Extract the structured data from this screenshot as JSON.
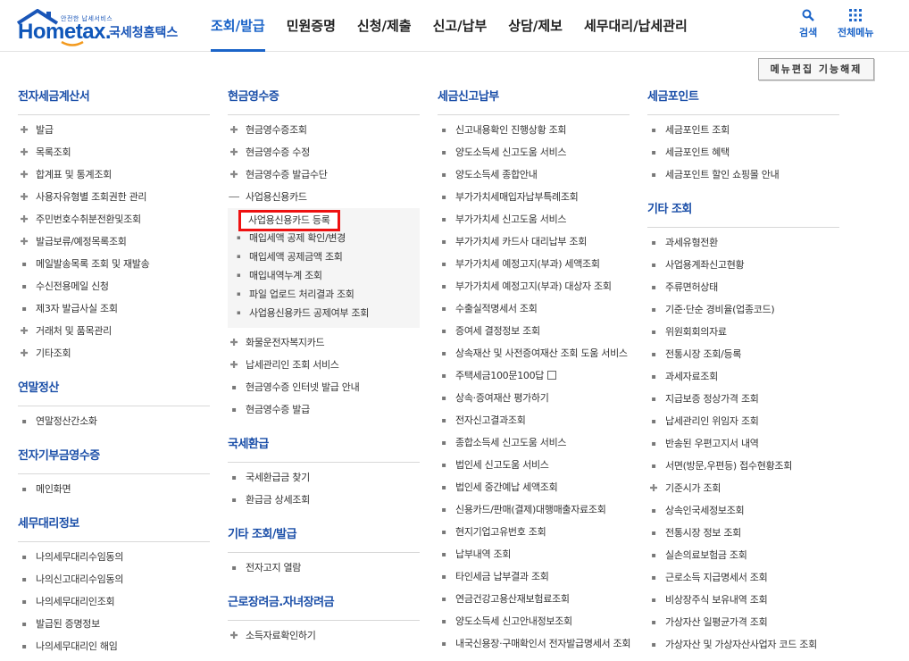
{
  "header": {
    "logo_small": "안전한 납세서비스",
    "logo_brand_a": "Hom",
    "logo_brand_e": "e",
    "logo_brand_b": "tax.",
    "logo_name": "국세청홈택스",
    "nav": [
      "조회/발급",
      "민원증명",
      "신청/제출",
      "신고/납부",
      "상담/제보",
      "세무대리/납세관리"
    ],
    "search_label": "검색",
    "allmenu_label": "전체메뉴"
  },
  "menu_edit_label": "메뉴편집 기능해제",
  "colors": {
    "brand": "#1a56b8",
    "accent": "#1b64c8",
    "highlight": "#ee1111"
  },
  "col1": [
    {
      "title": "전자세금계산서",
      "items": [
        {
          "label": "발급",
          "marker": "plus"
        },
        {
          "label": "목록조회",
          "marker": "plus"
        },
        {
          "label": "합계표 및 통계조회",
          "marker": "plus"
        },
        {
          "label": "사용자유형별 조회권한 관리",
          "marker": "plus"
        },
        {
          "label": "주민번호수취분전환및조회",
          "marker": "plus"
        },
        {
          "label": "발급보류/예정목록조회",
          "marker": "plus"
        },
        {
          "label": "메일발송목록 조회 및 재발송",
          "marker": "dot"
        },
        {
          "label": "수신전용메일 신청",
          "marker": "dot"
        },
        {
          "label": "제3자 발급사실 조회",
          "marker": "dot"
        },
        {
          "label": "거래처 및 품목관리",
          "marker": "plus"
        },
        {
          "label": "기타조회",
          "marker": "plus"
        }
      ]
    },
    {
      "title": "연말정산",
      "items": [
        {
          "label": "연말정산간소화",
          "marker": "dot"
        }
      ]
    },
    {
      "title": "전자기부금영수증",
      "items": [
        {
          "label": "메인화면",
          "marker": "dot"
        }
      ]
    },
    {
      "title": "세무대리정보",
      "items": [
        {
          "label": "나의세무대리수임동의",
          "marker": "dot"
        },
        {
          "label": "나의신고대리수임동의",
          "marker": "dot"
        },
        {
          "label": "나의세무대리인조회",
          "marker": "dot"
        },
        {
          "label": "발급된 증명정보",
          "marker": "dot"
        },
        {
          "label": "나의세무대리인 해임",
          "marker": "dot"
        }
      ]
    }
  ],
  "col2": [
    {
      "title": "현금영수증",
      "items": [
        {
          "label": "현금영수증조회",
          "marker": "plus"
        },
        {
          "label": "현금영수증 수정",
          "marker": "plus"
        },
        {
          "label": "현금영수증 발급수단",
          "marker": "plus"
        },
        {
          "label": "사업용신용카드",
          "marker": "minus"
        }
      ],
      "sub": [
        "사업용신용카드 등록",
        "매입세액 공제 확인/변경",
        "매입세액 공제금액 조회",
        "매입내역누계 조회",
        "파일 업로드 처리결과 조회",
        "사업용신용카드 공제여부 조회"
      ],
      "items_after": [
        {
          "label": "화물운전자복지카드",
          "marker": "plus"
        },
        {
          "label": "납세관리인 조회 서비스",
          "marker": "plus"
        },
        {
          "label": "현금영수증 인터넷 발급 안내",
          "marker": "dot"
        },
        {
          "label": "현금영수증 발급",
          "marker": "dot"
        }
      ]
    },
    {
      "title": "국세환급",
      "items": [
        {
          "label": "국세환급금 찾기",
          "marker": "dot"
        },
        {
          "label": "환급금 상세조회",
          "marker": "dot"
        }
      ]
    },
    {
      "title": "기타 조회/발급",
      "items": [
        {
          "label": "전자고지 열람",
          "marker": "dot"
        }
      ]
    },
    {
      "title": "근로장려금.자녀장려금",
      "items": [
        {
          "label": "소득자료확인하기",
          "marker": "plus"
        }
      ]
    }
  ],
  "col3": [
    {
      "title": "세금신고납부",
      "items": [
        {
          "label": "신고내용확인 진행상황 조회",
          "marker": "dot"
        },
        {
          "label": "양도소득세 신고도움 서비스",
          "marker": "dot"
        },
        {
          "label": "양도소득세 종합안내",
          "marker": "dot"
        },
        {
          "label": "부가가치세매입자납부특례조회",
          "marker": "dot"
        },
        {
          "label": "부가가치세 신고도움 서비스",
          "marker": "dot"
        },
        {
          "label": "부가가치세 카드사 대리납부 조회",
          "marker": "dot"
        },
        {
          "label": "부가가치세 예정고지(부과) 세액조회",
          "marker": "dot"
        },
        {
          "label": "부가가치세 예정고지(부과) 대상자 조회",
          "marker": "dot"
        },
        {
          "label": "수출실적명세서 조회",
          "marker": "dot"
        },
        {
          "label": "증여세 결정정보 조회",
          "marker": "dot"
        },
        {
          "label": "상속재산 및 사전증여재산 조회 도움 서비스",
          "marker": "dot"
        },
        {
          "label": "주택세금100문100답",
          "marker": "dot",
          "ext": true
        },
        {
          "label": "상속·증여재산 평가하기",
          "marker": "dot"
        },
        {
          "label": "전자신고결과조회",
          "marker": "dot"
        },
        {
          "label": "종합소득세 신고도움 서비스",
          "marker": "dot"
        },
        {
          "label": "법인세 신고도움 서비스",
          "marker": "dot"
        },
        {
          "label": "법인세 중간예납 세액조회",
          "marker": "dot"
        },
        {
          "label": "신용카드/판매(결제)대행매출자료조회",
          "marker": "dot"
        },
        {
          "label": "현지기업고유번호 조회",
          "marker": "dot"
        },
        {
          "label": "납부내역 조회",
          "marker": "dot"
        },
        {
          "label": "타인세금 납부결과 조회",
          "marker": "dot"
        },
        {
          "label": "연금건강고용산재보험료조회",
          "marker": "dot"
        },
        {
          "label": "양도소득세 신고안내정보조회",
          "marker": "dot"
        },
        {
          "label": "내국신용장·구매확인서 전자발급명세서 조회",
          "marker": "dot"
        }
      ]
    }
  ],
  "col4": [
    {
      "title": "세금포인트",
      "items": [
        {
          "label": "세금포인트 조회",
          "marker": "dot"
        },
        {
          "label": "세금포인트 혜택",
          "marker": "dot"
        },
        {
          "label": "세금포인트 할인 쇼핑몰 안내",
          "marker": "dot"
        }
      ]
    },
    {
      "title": "기타 조회",
      "items": [
        {
          "label": "과세유형전환",
          "marker": "dot"
        },
        {
          "label": "사업용계좌신고현황",
          "marker": "dot"
        },
        {
          "label": "주류면허상태",
          "marker": "dot"
        },
        {
          "label": "기준·단순 경비율(업종코드)",
          "marker": "dot"
        },
        {
          "label": "위원회회의자료",
          "marker": "dot"
        },
        {
          "label": "전통시장 조회/등록",
          "marker": "dot"
        },
        {
          "label": "과세자료조회",
          "marker": "dot"
        },
        {
          "label": "지급보증 정상가격 조회",
          "marker": "dot"
        },
        {
          "label": "납세관리인 위임자 조회",
          "marker": "dot"
        },
        {
          "label": "반송된 우편고지서 내역",
          "marker": "dot"
        },
        {
          "label": "서면(방문,우편등) 접수현황조회",
          "marker": "dot"
        },
        {
          "label": "기준시가 조회",
          "marker": "plus"
        },
        {
          "label": "상속인국세정보조회",
          "marker": "dot"
        },
        {
          "label": "전통시장 정보 조회",
          "marker": "dot"
        },
        {
          "label": "실손의료보험금 조회",
          "marker": "dot"
        },
        {
          "label": "근로소득 지급명세서 조회",
          "marker": "dot"
        },
        {
          "label": "비상장주식 보유내역 조회",
          "marker": "dot"
        },
        {
          "label": "가상자산 일평균가격 조회",
          "marker": "dot"
        },
        {
          "label": "가상자산 및 가상자산사업자 코드 조회",
          "marker": "dot"
        }
      ]
    }
  ]
}
